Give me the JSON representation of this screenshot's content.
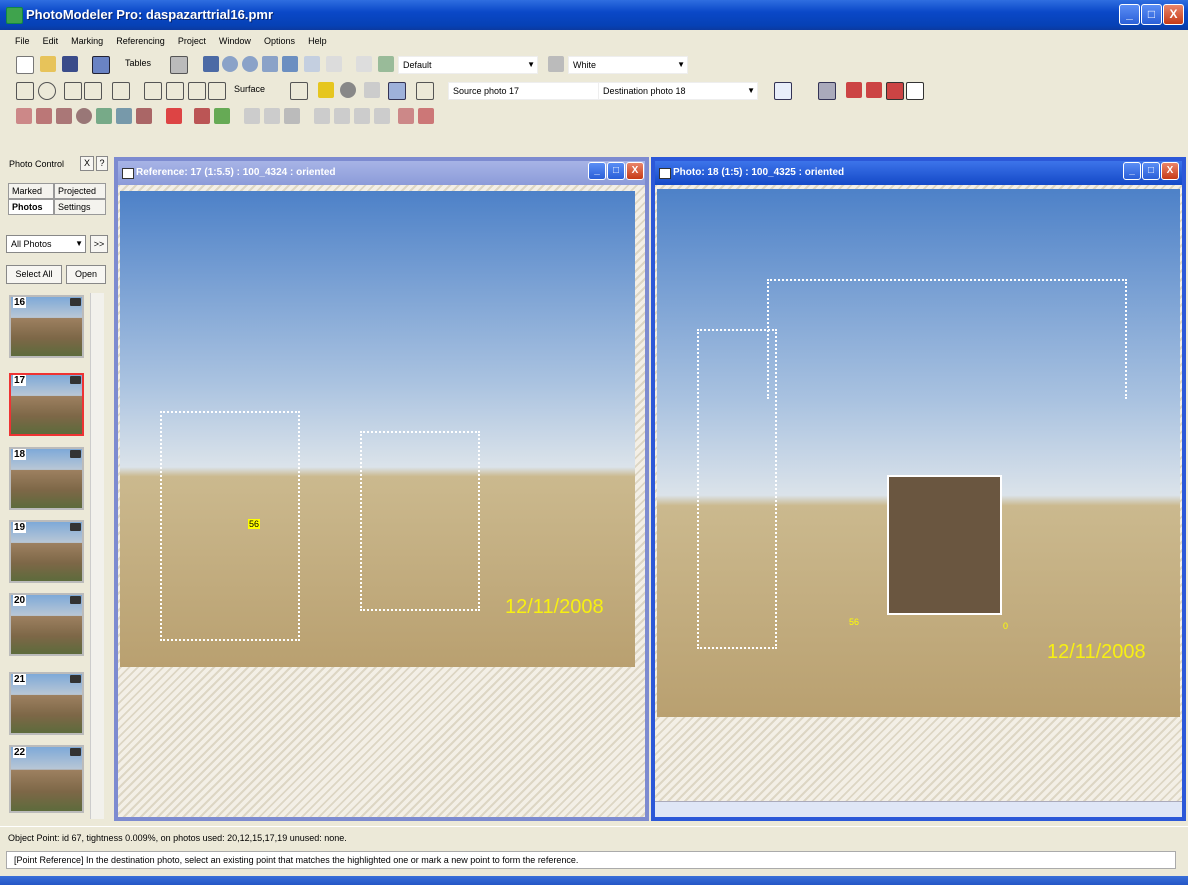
{
  "window": {
    "title": "PhotoModeler Pro: daspazarttrial16.pmr",
    "minimize": "_",
    "maximize": "□",
    "close": "X"
  },
  "menu": [
    "File",
    "Edit",
    "Marking",
    "Referencing",
    "Project",
    "Window",
    "Options",
    "Help"
  ],
  "toolbar1": {
    "tables_label": "Tables",
    "style_combo": "Default",
    "color_combo": "White"
  },
  "toolbar2": {
    "surface_label": "Surface",
    "source_combo": "Source photo 17",
    "dest_combo": "Destination photo 18"
  },
  "photo_control": {
    "title": "Photo Control",
    "close": "X",
    "help": "?",
    "tabs": [
      "Marked",
      "Projected",
      "Photos",
      "Settings"
    ],
    "filter": "All Photos",
    "more": ">>",
    "select_all": "Select All",
    "open": "Open",
    "thumbnails": [
      "16",
      "17",
      "18",
      "19",
      "20",
      "21",
      "22"
    ],
    "selected": "17"
  },
  "reference_window": {
    "title": "Reference: 17 (1:5.5) : 100_4324 : oriented",
    "date_stamp": "12/11/2008",
    "point_label": "56"
  },
  "photo_window": {
    "title": "Photo: 18 (1:5) : 100_4325 : oriented",
    "date_stamp": "12/11/2008",
    "point_label": "56",
    "point_label_2": "0"
  },
  "status": {
    "line1": "Object Point:  id 67,  tightness 0.009%,  on photos used: 20,12,15,17,19  unused: none.",
    "line2": "[Point Reference] In the destination photo, select an existing point that matches the highlighted one or mark a new point to form the reference."
  }
}
